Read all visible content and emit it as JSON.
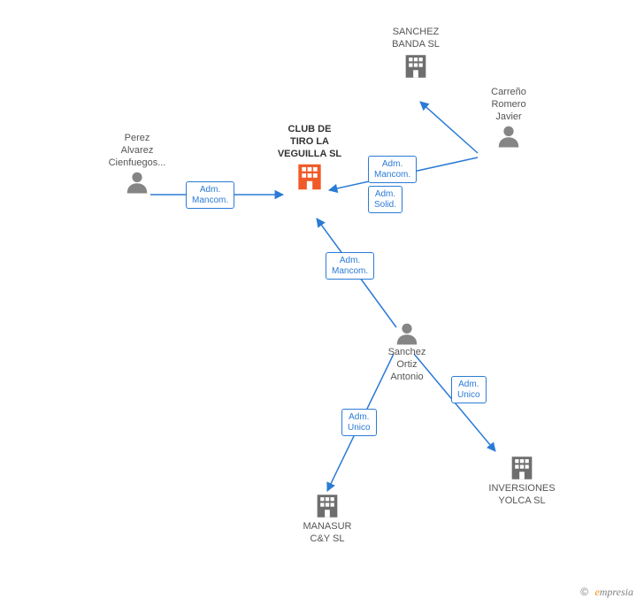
{
  "nodes": {
    "main": {
      "label": "CLUB DE\nTIRO LA\nVEGUILLA  SL"
    },
    "sanchez_banda": {
      "label": "SANCHEZ\nBANDA SL"
    },
    "carreno": {
      "label": "Carreño\nRomero\nJavier"
    },
    "perez": {
      "label": "Perez\nAlvarez\nCienfuegos..."
    },
    "sanchez_ortiz": {
      "label": "Sanchez\nOrtiz\nAntonio"
    },
    "manasur": {
      "label": "MANASUR\nC&Y SL"
    },
    "inversiones": {
      "label": "INVERSIONES\nYOLCA SL"
    }
  },
  "relations": {
    "r1": "Adm.\nMancom.",
    "r2": "Adm.\nMancom.",
    "r3": "Adm.\nSolid.",
    "r4": "Adm.\nMancom.",
    "r5": "Adm.\nUnico",
    "r6": "Adm.\nUnico"
  },
  "colors": {
    "accent": "#2b7bd6",
    "main_building": "#f05a28",
    "building": "#6e6e6e",
    "person": "#858585"
  },
  "footer": {
    "copyright": "©",
    "brand_initial": "e",
    "brand_rest": "mpresia"
  }
}
